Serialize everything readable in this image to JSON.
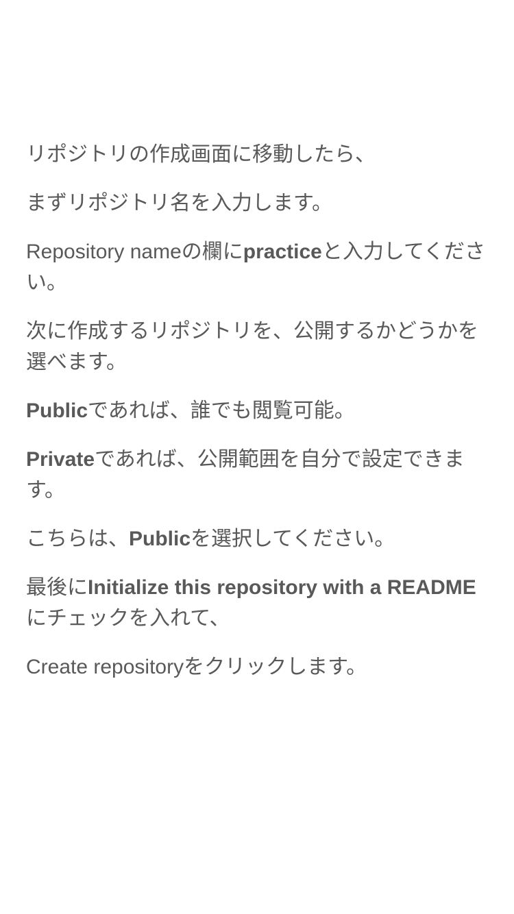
{
  "paragraphs": {
    "p1": "リポジトリの作成画面に移動したら、",
    "p2": "まずリポジトリ名を入力します。",
    "p3": {
      "a": "Repository name",
      "b": "の欄に",
      "c": "practice",
      "d": "と入力してください。"
    },
    "p4": "次に作成するリポジトリを、公開するかどうかを選べます。",
    "p5": {
      "a": "Public",
      "b": "であれば、誰でも閲覧可能。"
    },
    "p6": {
      "a": "Private",
      "b": "であれば、公開範囲を自分で設定できます。"
    },
    "p7": {
      "a": "こちらは、",
      "b": "Public",
      "c": "を選択してください。"
    },
    "p8": {
      "a": "最後に",
      "b": "Initialize this repository with a README",
      "c": "にチェックを入れて、"
    },
    "p9": {
      "a": "Create repository",
      "b": "をクリックします。"
    }
  }
}
